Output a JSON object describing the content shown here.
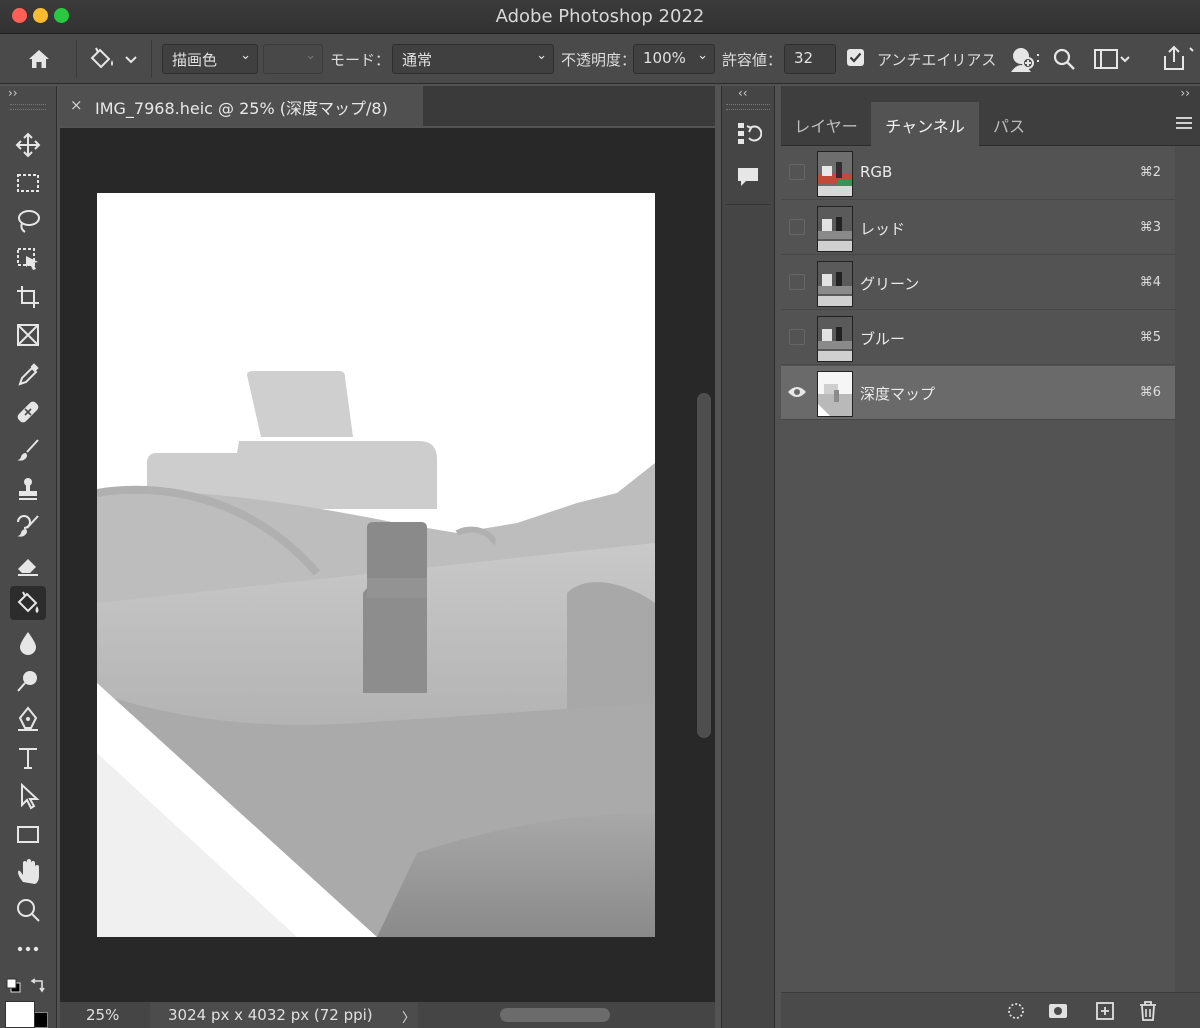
{
  "app": {
    "title": "Adobe Photoshop 2022"
  },
  "options_bar": {
    "fill_source": "描画色",
    "mode_label": "モード：",
    "mode_value": "通常",
    "opacity_label": "不透明度：",
    "opacity_value": "100%",
    "tolerance_label": "許容値：",
    "tolerance_value": "32",
    "antialias_label": "アンチエイリアス",
    "antialias_checked": true
  },
  "document": {
    "tab_title": "IMG_7968.heic @ 25% (深度マップ/8)",
    "close_glyph": "×"
  },
  "status_bar": {
    "zoom": "25%",
    "doc_info": "3024 px x 4032 px (72 ppi)",
    "arrow": "〉"
  },
  "panel": {
    "tabs": [
      {
        "label": "レイヤー",
        "active": false
      },
      {
        "label": "チャンネル",
        "active": true
      },
      {
        "label": "パス",
        "active": false
      }
    ],
    "channels": [
      {
        "name": "RGB",
        "shortcut": "⌘2",
        "visible": false,
        "selected": false
      },
      {
        "name": "レッド",
        "shortcut": "⌘3",
        "visible": false,
        "selected": false
      },
      {
        "name": "グリーン",
        "shortcut": "⌘4",
        "visible": false,
        "selected": false
      },
      {
        "name": "ブルー",
        "shortcut": "⌘5",
        "visible": false,
        "selected": false
      },
      {
        "name": "深度マップ",
        "shortcut": "⌘6",
        "visible": true,
        "selected": true
      }
    ]
  },
  "tools": [
    "move-tool",
    "marquee-tool",
    "lasso-tool",
    "object-select-tool",
    "crop-tool",
    "frame-tool",
    "eyedropper-tool",
    "healing-tool",
    "brush-tool",
    "stamp-tool",
    "history-brush-tool",
    "eraser-tool",
    "paint-bucket-tool",
    "blur-tool",
    "dodge-tool",
    "pen-tool",
    "type-tool",
    "path-select-tool",
    "rectangle-tool",
    "hand-tool",
    "zoom-tool",
    "more-tools"
  ],
  "active_tool": "paint-bucket-tool",
  "colors": {
    "foreground": "#ffffff",
    "background": "#000000",
    "accent": "#e8e8e8"
  }
}
